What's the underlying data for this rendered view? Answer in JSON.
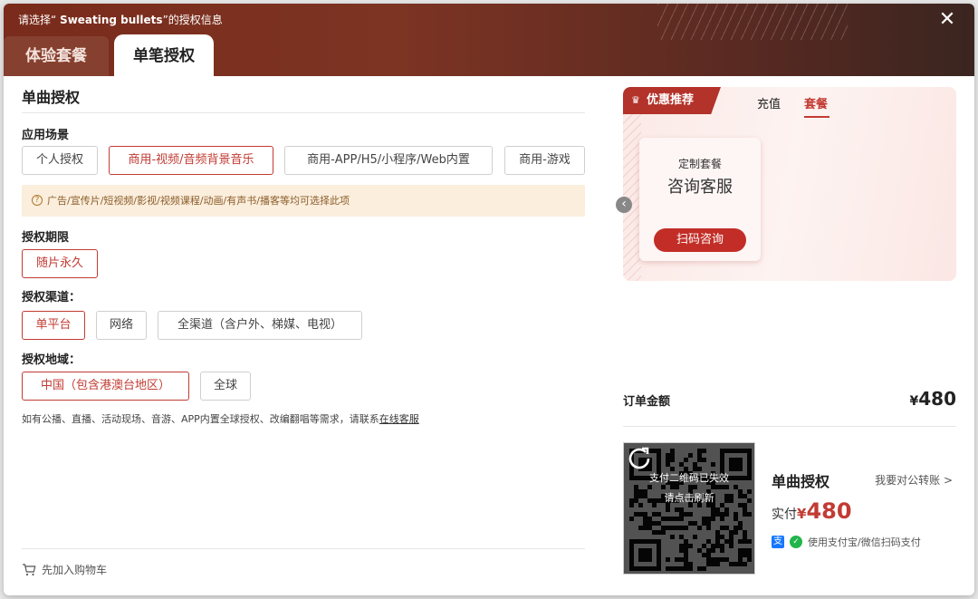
{
  "header": {
    "title_prefix": "请选择“ ",
    "title_song": "Sweating bullets",
    "title_suffix": "”的授权信息",
    "close_icon": "close-icon",
    "tabs": [
      {
        "label": "体验套餐",
        "active": false
      },
      {
        "label": "单笔授权",
        "active": true
      }
    ]
  },
  "section": {
    "title": "单曲授权",
    "scene_label": "应用场景",
    "scene_options": [
      {
        "label": "个人授权",
        "selected": false
      },
      {
        "label": "商用-视频/音频背景音乐",
        "selected": true
      },
      {
        "label": "商用-APP/H5/小程序/Web内置",
        "selected": false
      },
      {
        "label": "商用-游戏",
        "selected": false
      }
    ],
    "notice": "广告/宣传片/短视频/影视/视频课程/动画/有声书/播客等均可选择此项",
    "period_label": "授权期限",
    "period_options": [
      {
        "label": "随片永久",
        "selected": true
      }
    ],
    "channel_label": "授权渠道：",
    "channel_options": [
      {
        "label": "单平台",
        "selected": true
      },
      {
        "label": "网络",
        "selected": false
      },
      {
        "label": "全渠道（含户外、梯媒、电视）",
        "selected": false
      }
    ],
    "region_label": "授权地域：",
    "region_options": [
      {
        "label": "中国（包含港澳台地区）",
        "selected": true
      },
      {
        "label": "全球",
        "selected": false
      }
    ],
    "hint_text": "如有公播、直播、活动现场、音游、APP内置全球授权、改编翻唱等需求，请联系",
    "hint_link": "在线客服",
    "cart_label": "先加入购物车"
  },
  "promo": {
    "tag": "优惠推荐",
    "tabs": [
      {
        "label": "充值",
        "active": false
      },
      {
        "label": "套餐",
        "active": true
      }
    ],
    "package": {
      "title": "定制套餐",
      "subtitle": "咨询客服",
      "button": "扫码咨询"
    }
  },
  "order": {
    "label": "订单金额",
    "currency": "¥",
    "amount": "480"
  },
  "payment": {
    "qr_status_line1": "支付二维码已失效",
    "qr_status_line2": "请点击刷新",
    "title": "单曲授权",
    "transfer_link": "我要对公转账 >",
    "actual_label": "实付",
    "currency": "¥",
    "actual_amount": "480",
    "methods_text": "使用支付宝/微信扫码支付"
  },
  "colors": {
    "accent": "#c23b33",
    "header_bg": "#7a2b1b",
    "notice_bg": "#fbeedd"
  }
}
